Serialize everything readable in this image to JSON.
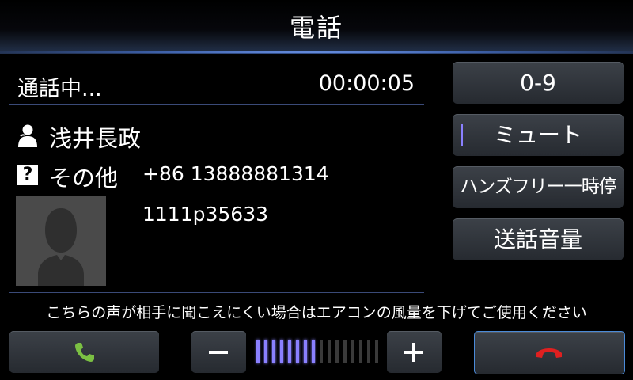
{
  "header": {
    "title": "電話"
  },
  "call": {
    "status": "通話中...",
    "timer": "00:00:05",
    "contact_name": "浅井長政",
    "number_label": "その他",
    "number": "+86 13888881314",
    "extra_digits": "1111p35633"
  },
  "side_buttons": {
    "keypad": "0-9",
    "mute": "ミュート",
    "handsfree": "ハンズフリー一時停止",
    "call_volume": "送話音量"
  },
  "notice": "こちらの声が相手に聞こえにくい場合はエアコンの風量を下げてご使用ください",
  "volume": {
    "level": 8,
    "max": 16
  },
  "icons": {
    "accept": "phone-accept-icon",
    "end": "phone-end-icon",
    "contact": "person-icon",
    "number_type": "question-icon",
    "decrease": "minus-icon",
    "increase": "plus-icon"
  },
  "colors": {
    "accept_green": "#7bc043",
    "end_red": "#e02020",
    "volume_active": "#8a80ff",
    "volume_inactive": "#3a3a3a",
    "accent_line": "#3a4a78"
  }
}
